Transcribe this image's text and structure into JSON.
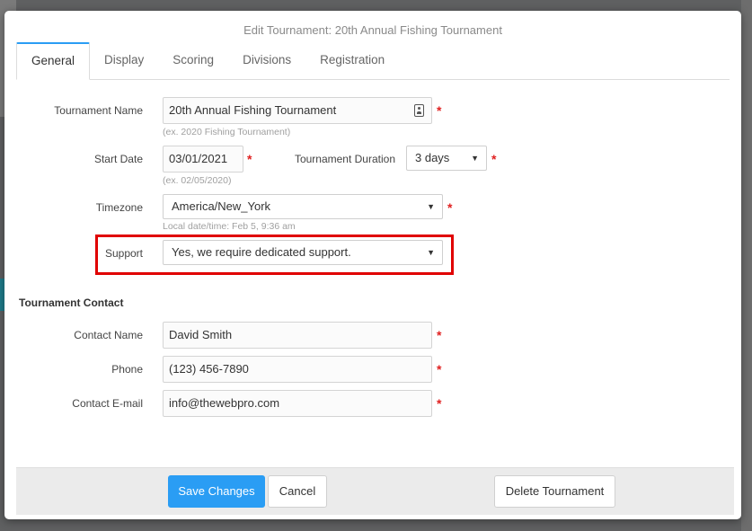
{
  "modal": {
    "title": "Edit Tournament: 20th Annual Fishing Tournament"
  },
  "tabs": [
    {
      "label": "General",
      "active": true
    },
    {
      "label": "Display",
      "active": false
    },
    {
      "label": "Scoring",
      "active": false
    },
    {
      "label": "Divisions",
      "active": false
    },
    {
      "label": "Registration",
      "active": false
    }
  ],
  "general": {
    "tournament_name": {
      "label": "Tournament Name",
      "value": "20th Annual Fishing Tournament",
      "hint": "(ex. 2020 Fishing Tournament)"
    },
    "start_date": {
      "label": "Start Date",
      "value": "03/01/2021",
      "hint": "(ex. 02/05/2020)"
    },
    "duration": {
      "label": "Tournament Duration",
      "value": "3 days"
    },
    "timezone": {
      "label": "Timezone",
      "value": "America/New_York",
      "hint": "Local date/time: Feb 5, 9:36 am"
    },
    "support": {
      "label": "Support",
      "value": "Yes, we require dedicated support."
    },
    "required_mark": "*"
  },
  "contact": {
    "section_title": "Tournament Contact",
    "name": {
      "label": "Contact Name",
      "value": "David Smith"
    },
    "phone": {
      "label": "Phone",
      "value": "(123) 456-7890"
    },
    "email": {
      "label": "Contact E-mail",
      "value": "info@thewebpro.com"
    }
  },
  "footer": {
    "save_label": "Save Changes",
    "cancel_label": "Cancel",
    "delete_label": "Delete Tournament"
  },
  "icons": {
    "caret": "▼",
    "contact_card": "contact-card-icon"
  },
  "colors": {
    "primary": "#2a9df4",
    "required": "#e02020",
    "highlight": "#e00000",
    "active_tab": "#2a9df4"
  }
}
